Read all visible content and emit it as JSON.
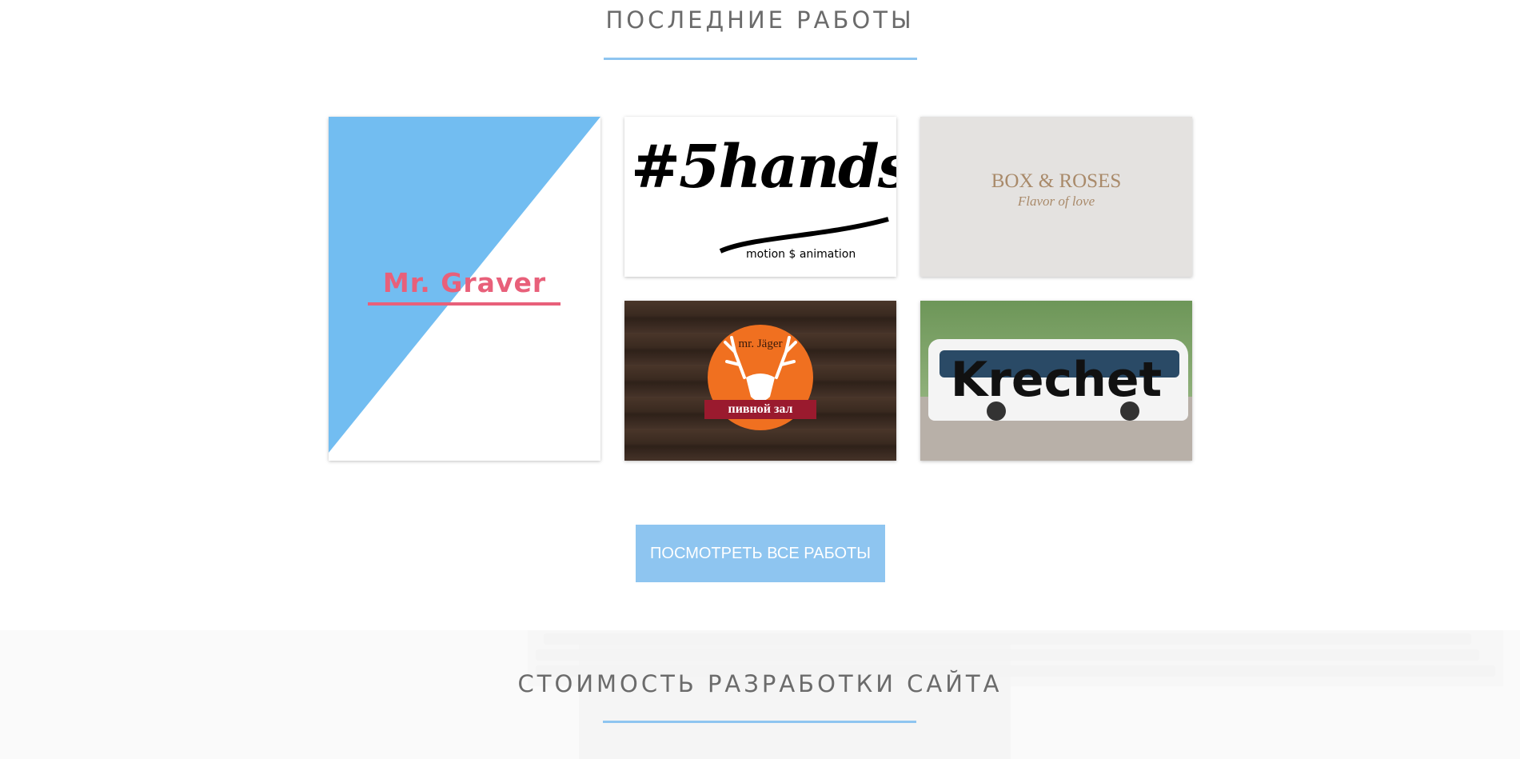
{
  "works_section": {
    "title": "ПОСЛЕДНИЕ РАБОТЫ",
    "accent_color": "#8ec5f0",
    "portfolio": [
      {
        "name": "Mr. Graver",
        "accent": "#e8607a",
        "background": [
          "#72bdf1",
          "#ffffff"
        ]
      },
      {
        "name": "#5hands",
        "subtitle": "motion $ animation"
      },
      {
        "name": "BOX & ROSES",
        "subtitle": "Flavor of love",
        "color": "#a98a6a"
      },
      {
        "name": "mr. Jäger",
        "subtitle": "пивной зал",
        "badge_color": "#f07020"
      },
      {
        "name": "Krechet"
      }
    ],
    "button_label": "ПОСМОТРЕТЬ ВСЕ РАБОТЫ"
  },
  "price_section": {
    "title": "СТОИМОСТЬ РАЗРАБОТКИ САЙТА"
  }
}
